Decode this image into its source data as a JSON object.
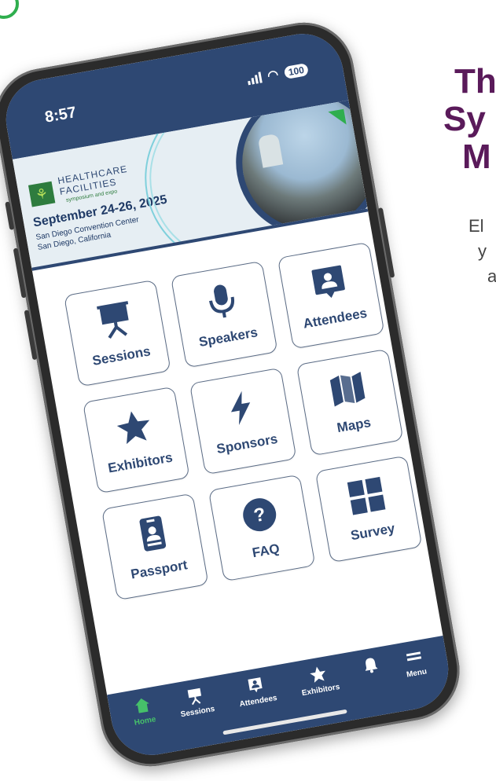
{
  "promo": {
    "headline": [
      "Th",
      "Sy",
      "M"
    ],
    "body": [
      "El",
      "y",
      "a"
    ]
  },
  "status_bar": {
    "time": "8:57",
    "battery": "100"
  },
  "banner": {
    "org_line1": "HEALTHCARE",
    "org_line2": "FACILITIES",
    "org_tagline": "symposium and expo",
    "dates": "September 24-26, 2025",
    "venue_line1": "San Diego Convention Center",
    "venue_line2": "San Diego, California"
  },
  "tiles": [
    {
      "label": "Sessions",
      "icon": "presentation-icon"
    },
    {
      "label": "Speakers",
      "icon": "microphone-icon"
    },
    {
      "label": "Attendees",
      "icon": "person-badge-icon"
    },
    {
      "label": "Exhibitors",
      "icon": "star-icon"
    },
    {
      "label": "Sponsors",
      "icon": "lightning-icon"
    },
    {
      "label": "Maps",
      "icon": "map-icon"
    },
    {
      "label": "Passport",
      "icon": "id-card-icon"
    },
    {
      "label": "FAQ",
      "icon": "question-icon"
    },
    {
      "label": "Survey",
      "icon": "grid-icon"
    }
  ],
  "tabbar": {
    "items": [
      {
        "label": "Home",
        "icon": "house-icon",
        "active": true
      },
      {
        "label": "Sessions",
        "icon": "presentation-icon",
        "active": false
      },
      {
        "label": "Attendees",
        "icon": "person-badge-icon",
        "active": false
      },
      {
        "label": "Exhibitors",
        "icon": "star-icon",
        "active": false
      },
      {
        "label": "",
        "icon": "bell-icon",
        "active": false
      },
      {
        "label": "Menu",
        "icon": "hamburger-icon",
        "active": false
      }
    ]
  },
  "colors": {
    "navy": "#2e4873",
    "active_green": "#46c06a",
    "headline_purple": "#5a1a5a"
  }
}
